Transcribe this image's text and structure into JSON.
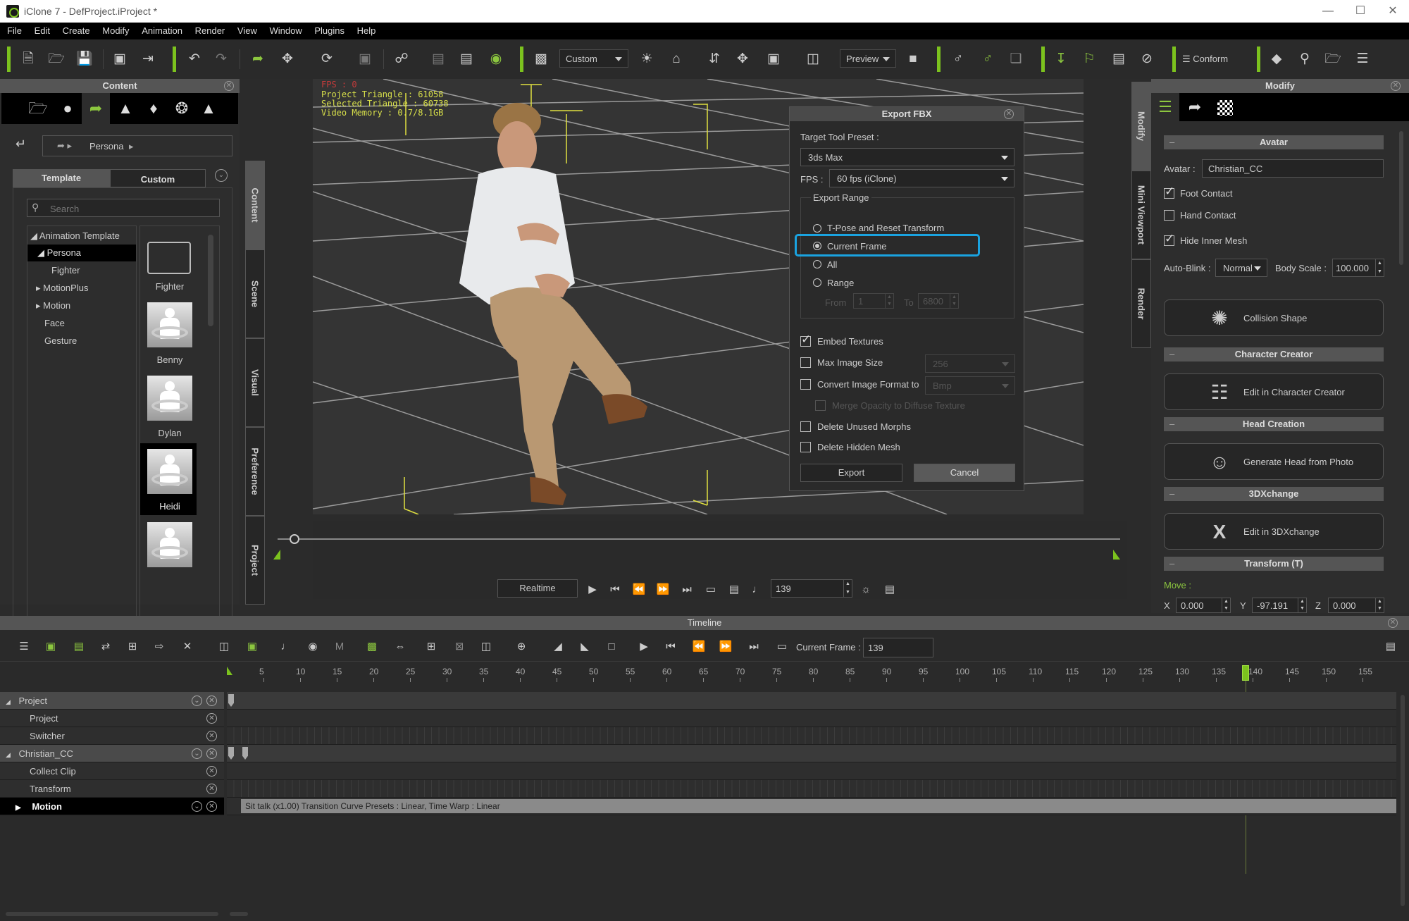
{
  "window": {
    "title": "iClone 7 - DefProject.iProject *",
    "controls": [
      "minimize",
      "maximize",
      "close"
    ]
  },
  "menu": [
    "File",
    "Edit",
    "Create",
    "Modify",
    "Animation",
    "Render",
    "View",
    "Window",
    "Plugins",
    "Help"
  ],
  "toolbar": {
    "camera_preset": "Custom",
    "render_mode": "Preview",
    "conform_label": "Conform",
    "accent_color": "#7cc21e"
  },
  "content_panel": {
    "title": "Content",
    "tabs": [
      "folder",
      "actor",
      "animation",
      "stage",
      "set",
      "media",
      "props"
    ],
    "breadcrumb": [
      "Persona"
    ],
    "subtabs": [
      "Template",
      "Custom"
    ],
    "active_subtab": "Template",
    "search_placeholder": "Search",
    "tree": [
      {
        "label": "Animation Template",
        "expanded": true,
        "level": 0
      },
      {
        "label": "Persona",
        "expanded": true,
        "level": 1,
        "selected": true
      },
      {
        "label": "Fighter",
        "level": 2
      },
      {
        "label": "MotionPlus",
        "expanded": false,
        "level": 1
      },
      {
        "label": "Motion",
        "expanded": false,
        "level": 1
      },
      {
        "label": "Face",
        "level": 1
      },
      {
        "label": "Gesture",
        "level": 1
      }
    ],
    "items": [
      {
        "label": "Fighter",
        "type": "folder"
      },
      {
        "label": "Benny",
        "type": "motion"
      },
      {
        "label": "Dylan",
        "type": "motion"
      },
      {
        "label": "Heidi",
        "type": "motion",
        "selected": true
      },
      {
        "label": "",
        "type": "motion"
      }
    ],
    "side_tabs": [
      "Content",
      "Scene",
      "Visual",
      "Preference",
      "Project"
    ]
  },
  "viewport": {
    "stats": [
      "Project Triangle : 61058",
      "Selected Triangle : 60738",
      "Video Memory : 0.7/8.1GB"
    ],
    "fps_indicator": "FPS : 0"
  },
  "export_dialog": {
    "title": "Export FBX",
    "target_tool_label": "Target Tool Preset :",
    "target_tool_value": "3ds Max",
    "fps_label": "FPS :",
    "fps_value": "60 fps (iClone)",
    "range_group": "Export Range",
    "range_options": [
      "T-Pose and Reset Transform",
      "Current Frame",
      "All",
      "Range"
    ],
    "range_selected": "Current Frame",
    "from_label": "From",
    "from_value": "1",
    "to_label": "To",
    "to_value": "6800",
    "options": [
      {
        "label": "Embed Textures",
        "checked": true,
        "enabled": true
      },
      {
        "label": "Max Image Size",
        "checked": false,
        "enabled": true,
        "value": "256"
      },
      {
        "label": "Convert Image Format to",
        "checked": false,
        "enabled": true,
        "value": "Bmp"
      },
      {
        "label": "Merge Opacity to Diffuse Texture",
        "checked": false,
        "enabled": false
      },
      {
        "label": "Delete Unused Morphs",
        "checked": false,
        "enabled": true
      },
      {
        "label": "Delete Hidden Mesh",
        "checked": false,
        "enabled": true
      }
    ],
    "export_label": "Export",
    "cancel_label": "Cancel",
    "highlight_color": "#1aa3e0"
  },
  "modify_panel": {
    "title": "Modify",
    "side_tabs": [
      "Modify",
      "Mini Viewport",
      "Render"
    ],
    "sections": {
      "avatar": {
        "title": "Avatar",
        "avatar_label": "Avatar :",
        "avatar_value": "Christian_CC",
        "foot_contact": {
          "label": "Foot Contact",
          "checked": true
        },
        "hand_contact": {
          "label": "Hand Contact",
          "checked": false
        },
        "hide_inner_mesh": {
          "label": "Hide Inner Mesh",
          "checked": true
        },
        "auto_blink_label": "Auto-Blink :",
        "auto_blink_value": "Normal",
        "body_scale_label": "Body Scale :",
        "body_scale_value": "100.000",
        "collision_shape": "Collision Shape"
      },
      "character_creator": {
        "title": "Character Creator",
        "button": "Edit in Character Creator"
      },
      "head_creation": {
        "title": "Head Creation",
        "button": "Generate Head from Photo"
      },
      "threedxchange": {
        "title": "3DXchange",
        "button": "Edit in 3DXchange"
      },
      "transform": {
        "title": "Transform  (T)",
        "move_label": "Move :",
        "x_label": "X",
        "x": "0.000",
        "y_label": "Y",
        "y": "-97.191",
        "z_label": "Z",
        "z": "0.000"
      }
    }
  },
  "playback": {
    "mode": "Realtime",
    "frame": "139",
    "slider_position": 0.02
  },
  "timeline": {
    "title": "Timeline",
    "current_frame_label": "Current Frame :",
    "current_frame": "139",
    "ruler": [
      5,
      10,
      15,
      20,
      25,
      30,
      35,
      40,
      45,
      50,
      55,
      60,
      65,
      70,
      75,
      80,
      85,
      90,
      95,
      100,
      105,
      110,
      115,
      120,
      125,
      130,
      135,
      140,
      145,
      150,
      155
    ],
    "playhead_frame": 139,
    "tracks": [
      {
        "label": "Project",
        "type": "group"
      },
      {
        "label": "Project",
        "type": "child"
      },
      {
        "label": "Switcher",
        "type": "child"
      },
      {
        "label": "Christian_CC",
        "type": "group"
      },
      {
        "label": "Collect Clip",
        "type": "child"
      },
      {
        "label": "Transform",
        "type": "child"
      },
      {
        "label": "Motion",
        "type": "motion"
      }
    ],
    "motion_clip": "Sit talk (x1.00) Transition Curve Presets : Linear, Time Warp : Linear"
  }
}
